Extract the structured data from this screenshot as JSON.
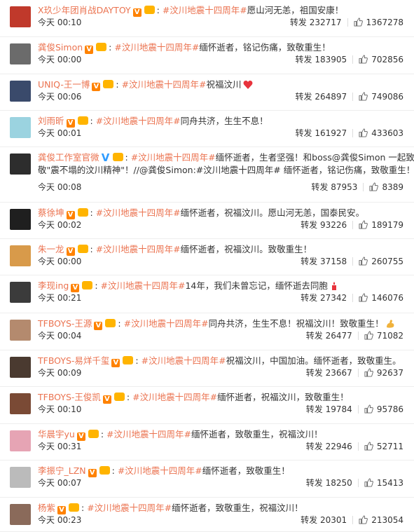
{
  "ui": {
    "repost_label": "转发",
    "accent_color": "#eb7350",
    "like_icon": "thumbs-up-icon"
  },
  "posts": [
    {
      "name": "X玖少年团肖战DAYTOY",
      "badge": "V",
      "tag": "#汶川地震十四周年#",
      "text": "愿山河无恙，祖国安康！",
      "text2": "",
      "time": "今天 00:10",
      "reposts": "232717",
      "likes": "1367278"
    },
    {
      "name": "龚俊Simon",
      "badge": "V",
      "tag": "#汶川地震十四周年#",
      "text": "缅怀逝者，铭记伤痛，致敬重生！",
      "text2": "",
      "time": "今天 00:00",
      "reposts": "183905",
      "likes": "702856"
    },
    {
      "name": "UNIQ-王一博",
      "badge": "V",
      "tag": "#汶川地震十四周年#",
      "text": "祝福汶川",
      "text2": "",
      "time": "今天 00:06",
      "reposts": "264897",
      "likes": "749086",
      "emoji": "heart-emoji-icon"
    },
    {
      "name": "刘雨昕",
      "badge": "V",
      "tag": "#汶川地震十四周年#",
      "text": "同舟共济，生生不息！",
      "text2": "",
      "time": "今天 00:01",
      "reposts": "161927",
      "likes": "433603"
    },
    {
      "name": "龚俊工作室官微",
      "badge": "V",
      "tag": "#汶川地震十四周年#",
      "text": "缅怀逝者，生者坚强！和boss@龚俊Simon 一起致",
      "text2": "敬\"震不塌的汶川精神\"！//@龚俊Simon:#汶川地震十四周年# 缅怀逝者，铭记伤痛，致敬重生！",
      "time": "今天 00:08",
      "reposts": "87953",
      "likes": "8389"
    },
    {
      "name": "蔡徐坤",
      "badge": "V",
      "tag": "#汶川地震十四周年#",
      "text": "缅怀逝者，祝福汶川。愿山河无恙，国泰民安。",
      "text2": "",
      "time": "今天 00:02",
      "reposts": "93226",
      "likes": "189179"
    },
    {
      "name": "朱一龙",
      "badge": "V",
      "tag": "#汶川地震十四周年#",
      "text": "缅怀逝者，祝福汶川。致敬重生！",
      "text2": "",
      "time": "今天 00:00",
      "reposts": "37158",
      "likes": "260755"
    },
    {
      "name": "李现ing",
      "badge": "V",
      "tag": "#汶川地震十四周年#",
      "text": "14年，我们未曾忘记，缅怀逝去同胞",
      "text2": "",
      "time": "今天 00:21",
      "reposts": "27342",
      "likes": "146076",
      "emoji": "candle-emoji-icon"
    },
    {
      "name": "TFBOYS-王源",
      "badge": "V",
      "tag": "#汶川地震十四周年#",
      "text": "同舟共济，生生不息！祝福汶川！致敬重生！",
      "text2": "",
      "time": "今天 00:04",
      "reposts": "26477",
      "likes": "71082",
      "emoji": "muscle-emoji-icon"
    },
    {
      "name": "TFBOYS-易烊千玺",
      "badge": "V",
      "tag": "#汶川地震十四周年#",
      "text": "祝福汶川，中国加油。缅怀逝者，致敬重生。",
      "text2": "",
      "time": "今天 00:09",
      "reposts": "23667",
      "likes": "92637"
    },
    {
      "name": "TFBOYS-王俊凯",
      "badge": "V",
      "tag": "#汶川地震十四周年#",
      "text": "缅怀逝者，祝福汶川，致敬重生！",
      "text2": "",
      "time": "今天 00:10",
      "reposts": "19784",
      "likes": "95786"
    },
    {
      "name": "华晨宇yu",
      "badge": "V",
      "tag": "#汶川地震十四周年#",
      "text": "缅怀逝者，致敬重生，祝福汶川！",
      "text2": "",
      "time": "今天 00:31",
      "reposts": "22946",
      "likes": "52711"
    },
    {
      "name": "李振宁_LZN",
      "badge": "V",
      "tag": "#汶川地震十四周年#",
      "text": "缅怀逝者，致敬重生！",
      "text2": "",
      "time": "今天 00:07",
      "reposts": "18250",
      "likes": "15413"
    },
    {
      "name": "杨紫",
      "badge": "V",
      "tag": "#汶川地震十四周年#",
      "text": "缅怀逝者，致敬重生，祝福汶川！",
      "text2": "",
      "time": "今天 00:23",
      "reposts": "20301",
      "likes": "213054"
    }
  ]
}
